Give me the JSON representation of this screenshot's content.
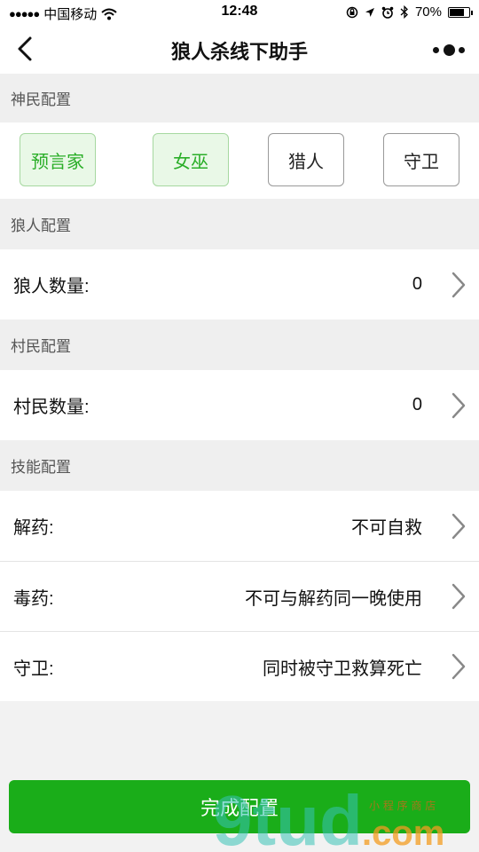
{
  "status_bar": {
    "signal_dots": "●●●●●",
    "carrier": "中国移动",
    "time": "12:48",
    "battery_percent": "70%",
    "icons": [
      "wifi-icon",
      "rotation-lock-icon",
      "location-icon",
      "alarm-icon",
      "bluetooth-icon",
      "battery-icon"
    ]
  },
  "nav": {
    "title": "狼人杀线下助手",
    "back_icon": "chevron-left-icon",
    "more_icon": "more-dots-icon"
  },
  "sections": {
    "gods": {
      "header": "神民配置",
      "roles": [
        {
          "label": "预言家",
          "selected": true
        },
        {
          "label": "女巫",
          "selected": true
        },
        {
          "label": "猎人",
          "selected": false
        },
        {
          "label": "守卫",
          "selected": false
        }
      ]
    },
    "wolves": {
      "header": "狼人配置",
      "label": "狼人数量:",
      "value": "0"
    },
    "villagers": {
      "header": "村民配置",
      "label": "村民数量:",
      "value": "0"
    },
    "skills": {
      "header": "技能配置",
      "items": [
        {
          "label": "解药:",
          "value": "不可自救"
        },
        {
          "label": "毒药:",
          "value": "不可与解药同一晚使用"
        },
        {
          "label": "守卫:",
          "value": "同时被守卫救算死亡"
        }
      ]
    }
  },
  "done_button": "完成配置",
  "watermark": {
    "text": "9tud.com",
    "sub": "小程序商店"
  },
  "colors": {
    "accent": "#1aad19",
    "selected_bg": "#e9f8e7",
    "selected_text": "#2aae28"
  }
}
